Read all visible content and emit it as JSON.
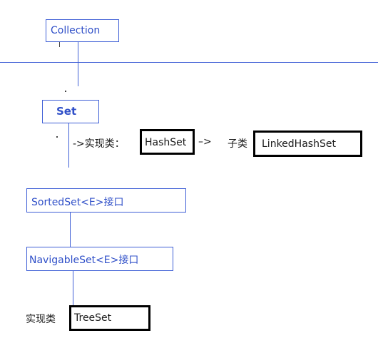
{
  "diagram": {
    "collection": "Collection",
    "set": "Set",
    "impl_prefix": "->实现类：",
    "hashset": "HashSet",
    "arrow2": "–>",
    "subclass_label": "子类",
    "linkedhashset": "LinkedHashSet",
    "sortedset": "SortedSet<E>接口",
    "navigableset": "NavigableSet<E>接口",
    "treeset_prefix": "实现类",
    "treeset": "TreeSet"
  },
  "colors": {
    "line": "#3f5fd6",
    "box_text": "#2f4fc8"
  }
}
